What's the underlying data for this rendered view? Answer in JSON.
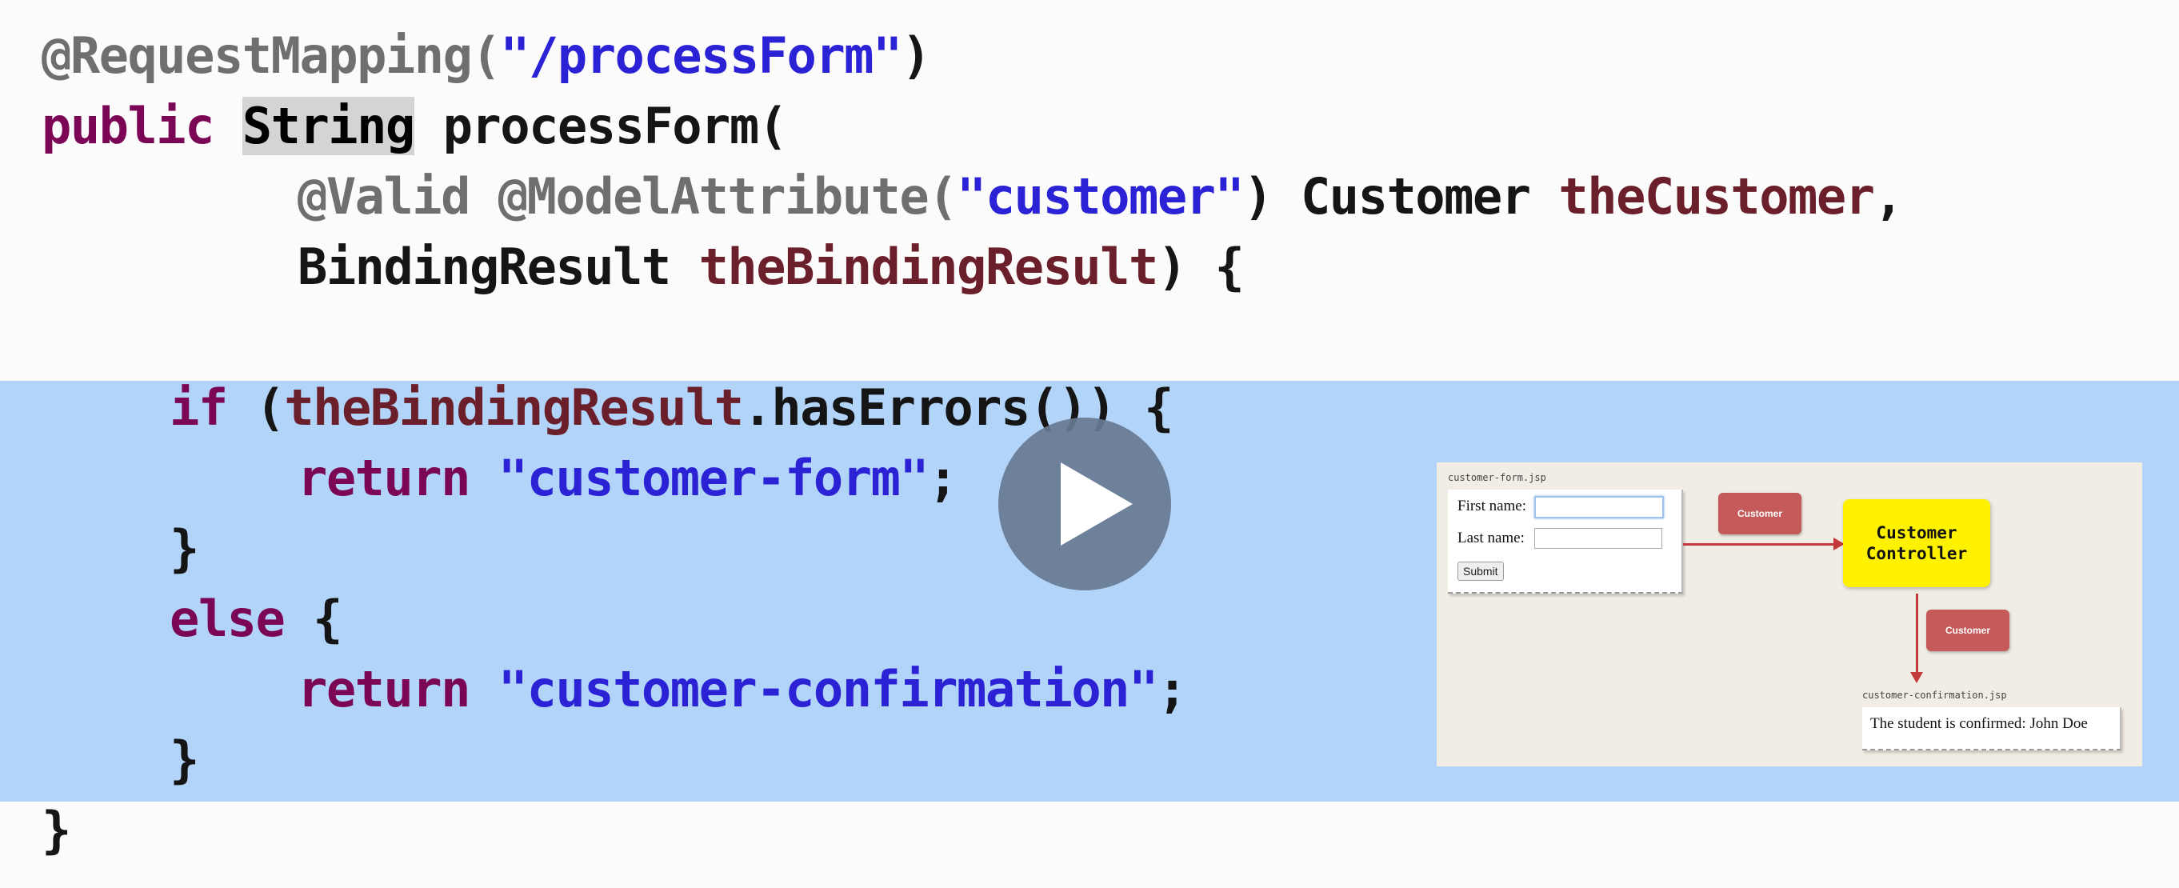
{
  "code": {
    "lines": [
      [
        {
          "t": "@RequestMapping(",
          "c": "annotation"
        },
        {
          "t": "\"/processForm\"",
          "c": "string"
        },
        {
          "t": ")",
          "c": "plain"
        }
      ],
      [
        {
          "t": "public",
          "c": "keyword"
        },
        {
          "t": " ",
          "c": "plain"
        },
        {
          "t": "String",
          "c": "selected"
        },
        {
          "t": " processForm(",
          "c": "plain"
        }
      ],
      [
        {
          "t": "@Valid @ModelAttribute(",
          "c": "annotation"
        },
        {
          "t": "\"customer\"",
          "c": "string"
        },
        {
          "t": ") Customer ",
          "c": "plain"
        },
        {
          "t": "theCustomer",
          "c": "field"
        },
        {
          "t": ",",
          "c": "plain"
        }
      ],
      [
        {
          "t": "BindingResult ",
          "c": "plain"
        },
        {
          "t": "theBindingResult",
          "c": "field"
        },
        {
          "t": ") {",
          "c": "plain"
        }
      ],
      [],
      [
        {
          "t": "if",
          "c": "keyword"
        },
        {
          "t": " (",
          "c": "plain"
        },
        {
          "t": "theBindingResult",
          "c": "field"
        },
        {
          "t": ".hasErrors()) {",
          "c": "plain"
        }
      ],
      [
        {
          "t": "return",
          "c": "keyword"
        },
        {
          "t": " ",
          "c": "plain"
        },
        {
          "t": "\"customer-form\"",
          "c": "string"
        },
        {
          "t": ";",
          "c": "plain"
        }
      ],
      [
        {
          "t": "}",
          "c": "plain"
        }
      ],
      [
        {
          "t": "else",
          "c": "keyword"
        },
        {
          "t": " {",
          "c": "plain"
        }
      ],
      [
        {
          "t": "return",
          "c": "keyword"
        },
        {
          "t": " ",
          "c": "plain"
        },
        {
          "t": "\"customer-confirmation\"",
          "c": "string"
        },
        {
          "t": ";",
          "c": "plain"
        }
      ],
      [
        {
          "t": "}",
          "c": "plain"
        }
      ],
      [
        {
          "t": "}",
          "c": "plain"
        }
      ]
    ]
  },
  "video": {
    "play_icon": "play-icon"
  },
  "thumbnail": {
    "form_file": "customer-form.jsp",
    "first_name_label": "First name:",
    "last_name_label": "Last name:",
    "submit_label": "Submit",
    "chip_label_1": "Customer",
    "chip_label_2": "Customer",
    "controller_line_1": "Customer",
    "controller_line_2": "Controller",
    "confirm_file": "customer-confirmation.jsp",
    "confirm_text": "The student is confirmed: John Doe"
  },
  "colors": {
    "highlight": "#b3d4f9",
    "annotation": "#6f6f6f",
    "keyword": "#7a0655",
    "string": "#2b22d6",
    "field": "#6b1f2a",
    "controller": "#fff200",
    "model_chip": "#c45a5a"
  }
}
